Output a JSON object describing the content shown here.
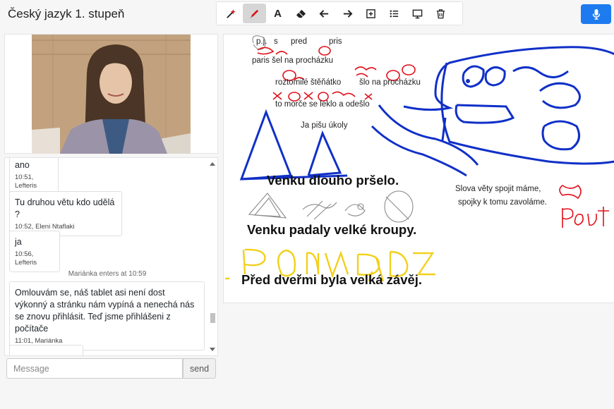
{
  "header": {
    "title": "Český jazyk 1. stupeň"
  },
  "toolbar": {
    "tools": [
      {
        "name": "magic-wand",
        "icon": "magic-wand-icon"
      },
      {
        "name": "pen",
        "icon": "pencil-icon",
        "active": true
      },
      {
        "name": "text",
        "icon": "text-icon",
        "glyph": "A"
      },
      {
        "name": "eraser",
        "icon": "eraser-icon"
      },
      {
        "name": "undo",
        "icon": "arrow-left-icon"
      },
      {
        "name": "redo",
        "icon": "arrow-right-icon"
      },
      {
        "name": "add",
        "icon": "plus-square-icon"
      },
      {
        "name": "list",
        "icon": "list-icon"
      },
      {
        "name": "screen",
        "icon": "monitor-icon"
      },
      {
        "name": "delete",
        "icon": "trash-icon"
      }
    ],
    "mic_icon": "microphone-icon",
    "accent": "#1d7bef"
  },
  "chat": {
    "messages": [
      {
        "text": "ano",
        "time": "10:51",
        "author": "Lefteris"
      },
      {
        "text": "Tu druhou větu kdo udělá ?",
        "time": "10:52",
        "author": "Eleni Ntaflaki"
      },
      {
        "text": "ja",
        "time": "10:56",
        "author": "Lefteris"
      },
      {
        "text": "Omlouvám se, náš tablet asi není dost výkonný a stránku nám vypíná a nenechá nás se znovu přihlásit. Teď jsme přihlášeni z počítače",
        "time": "11:01",
        "author": "Mariánka"
      }
    ],
    "system": "Mariánka enters at 10:59",
    "input_placeholder": "Message",
    "send_label": "send"
  },
  "board": {
    "small_texts": {
      "pj": "p.j.",
      "s": "s",
      "pred": "pred",
      "pris": "pris",
      "paris": "paris šel na procházku",
      "roztomile": "roztomilé štěňátko",
      "slo": "šlo na procházku",
      "morce": "to morče se leklo a odešlo",
      "ukoly": "Ja pišu úkoly",
      "slova1": "Slova věty spojit máme,",
      "slova2": "spojky k tomu zavoláme."
    },
    "sentences": {
      "s1": "Venku dlouho pršelo.",
      "s2": "Venku padaly velké kroupy.",
      "s3": "Před dveřmi byla velká závěj."
    },
    "handwriting": "Pouta",
    "ink_colors": {
      "blue": "#1030c8",
      "red": "#e0101a",
      "yellow": "#f2d01a",
      "gray": "#8a8a8a"
    }
  }
}
